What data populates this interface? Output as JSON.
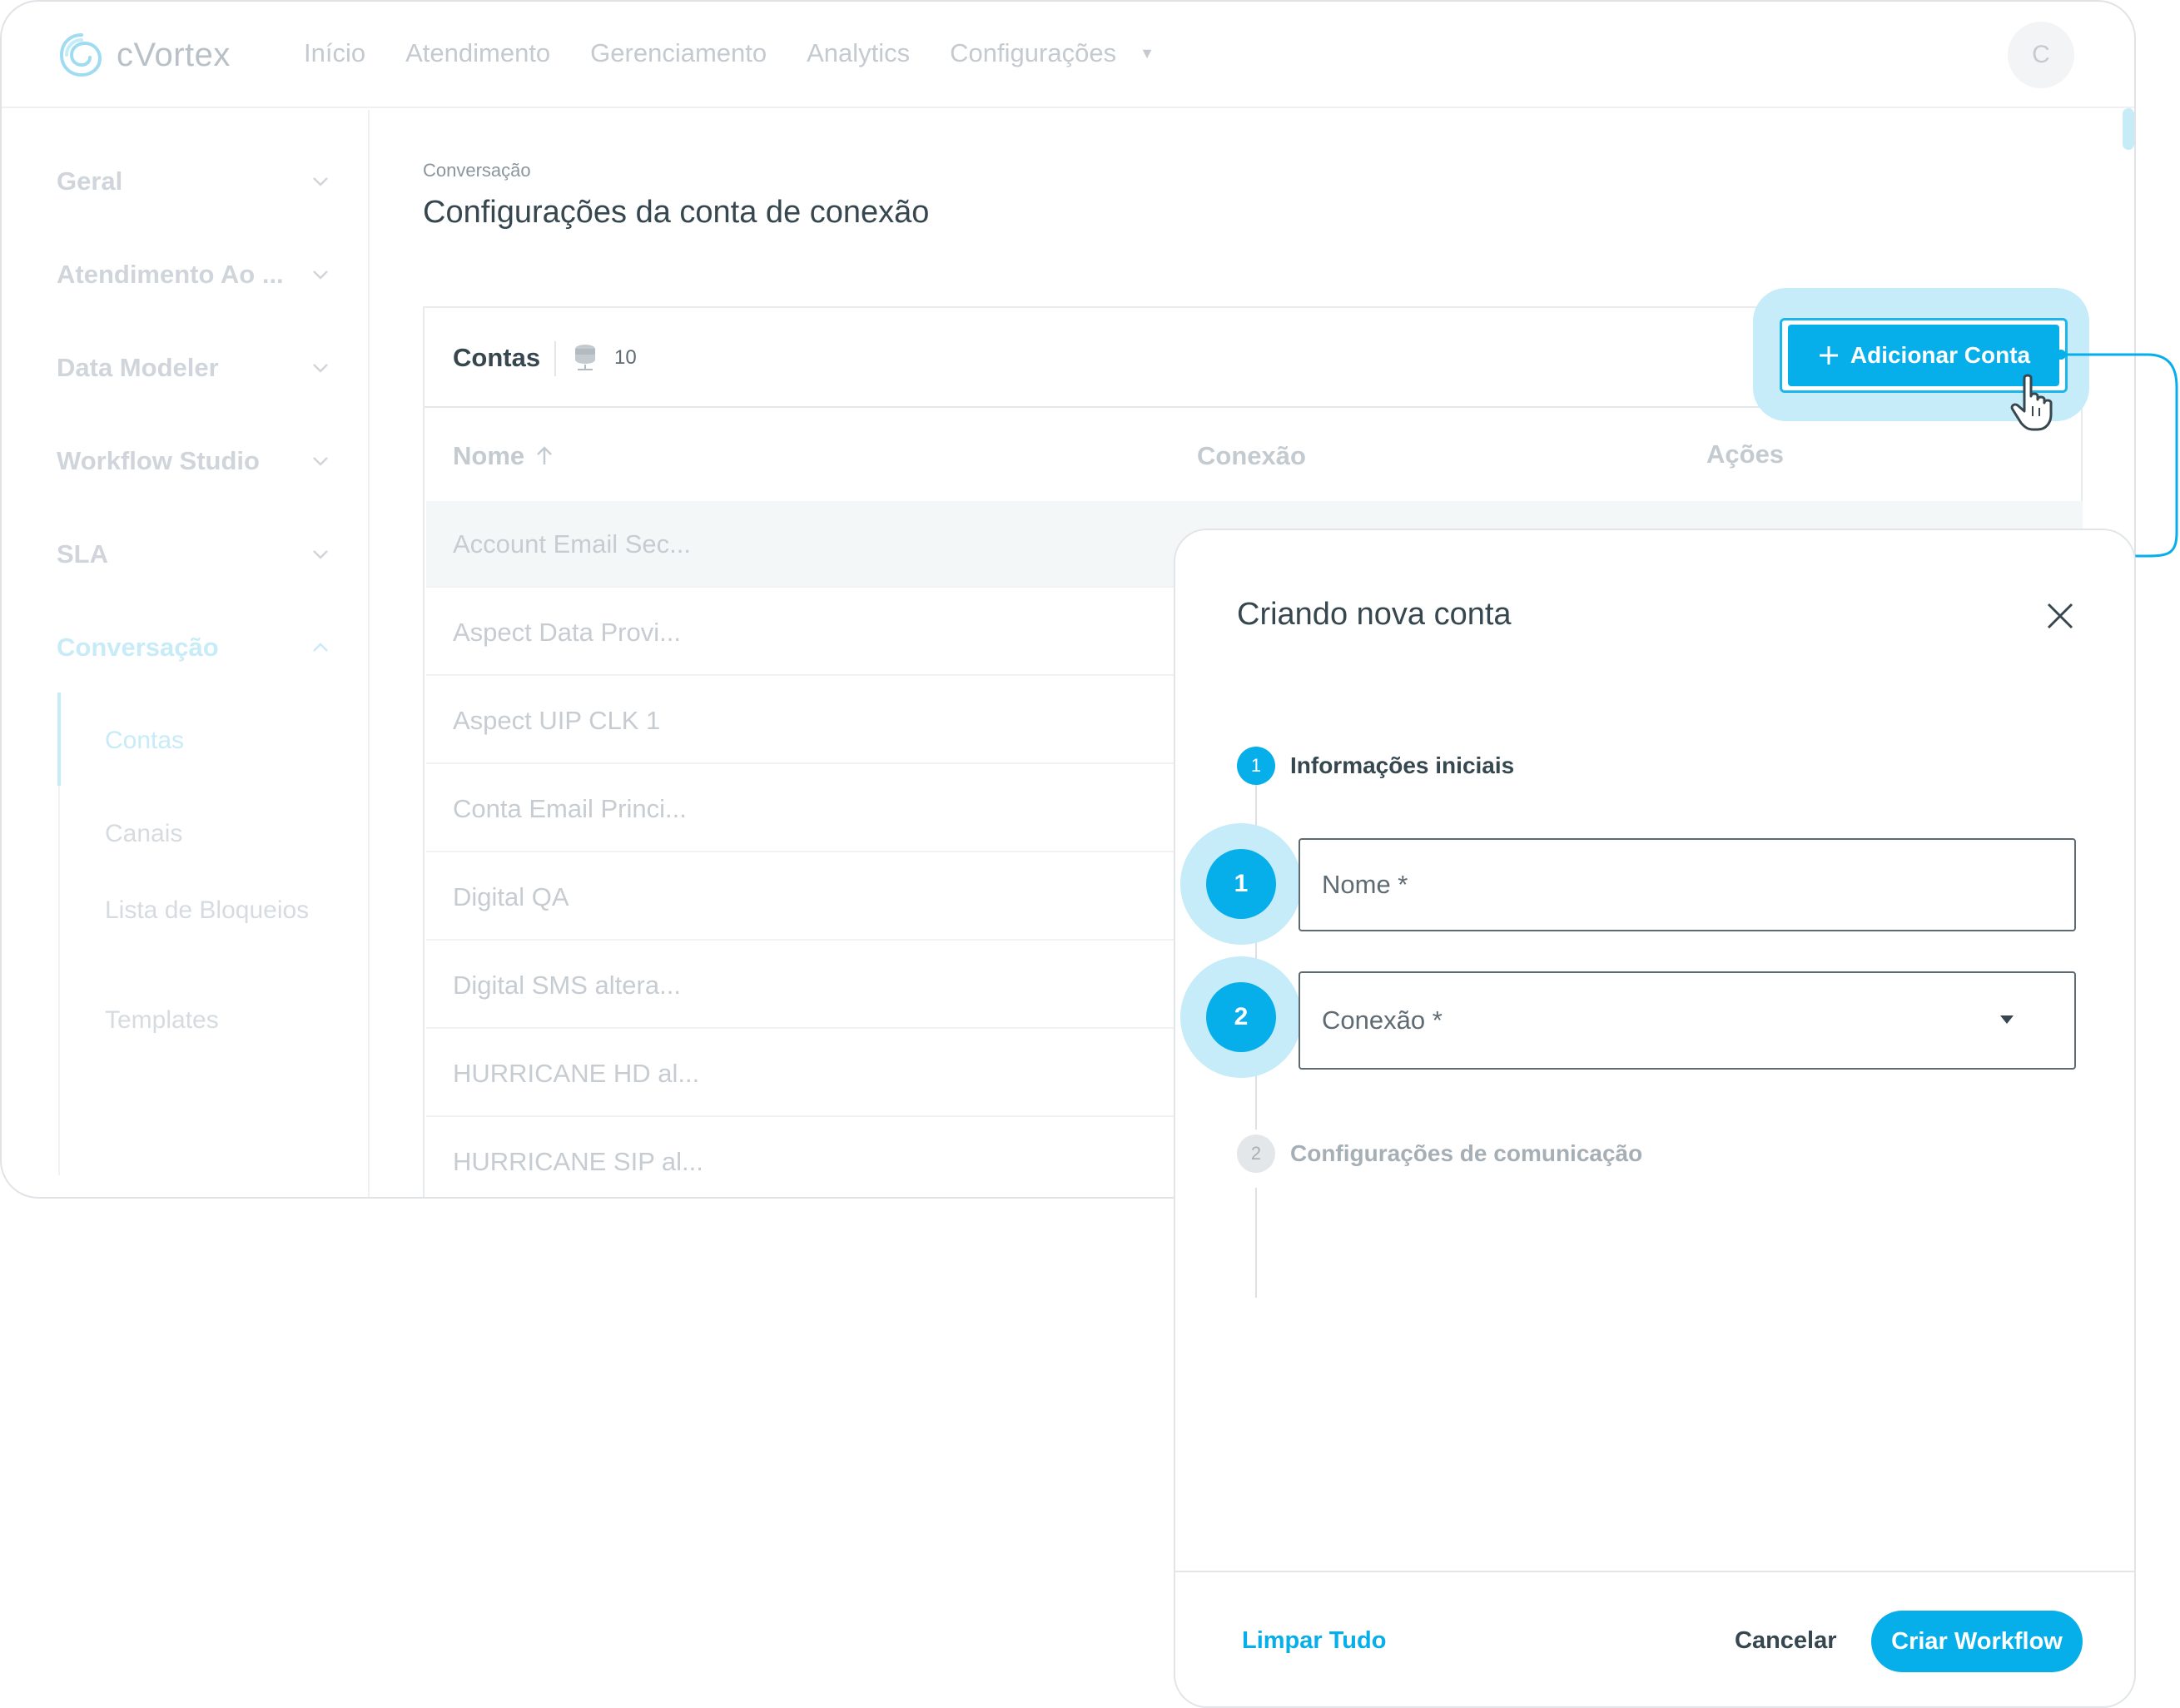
{
  "app": {
    "logo_text": "cVortex",
    "avatar_initial": "C"
  },
  "nav": {
    "items": [
      "Início",
      "Atendimento",
      "Gerenciamento",
      "Analytics",
      "Configurações"
    ]
  },
  "sidebar": {
    "items": [
      {
        "label": "Geral"
      },
      {
        "label": "Atendimento Ao ..."
      },
      {
        "label": "Data Modeler"
      },
      {
        "label": "Workflow Studio"
      },
      {
        "label": "SLA"
      },
      {
        "label": "Conversação"
      }
    ],
    "sub_items": [
      "Contas",
      "Canais",
      "Lista de Bloqueios",
      "Templates"
    ]
  },
  "page": {
    "breadcrumb": "Conversação",
    "title": "Configurações da conta de conexão"
  },
  "table": {
    "title": "Contas",
    "count": "10",
    "add_button": "Adicionar Conta",
    "columns": [
      "Nome",
      "Conexão",
      "Ações"
    ],
    "rows": [
      "Account Email Sec...",
      "Aspect Data Provi...",
      "Aspect UIP CLK 1",
      "Conta Email Princi...",
      "Digital QA",
      "Digital SMS altera...",
      "HURRICANE HD al...",
      "HURRICANE SIP al..."
    ]
  },
  "drawer": {
    "title": "Criando nova conta",
    "steps": [
      {
        "number": "1",
        "label": "Informações iniciais"
      },
      {
        "number": "2",
        "label": "Configurações de comunicação"
      }
    ],
    "callouts": [
      "1",
      "2"
    ],
    "fields": {
      "name_placeholder": "Nome *",
      "connection_placeholder": "Conexão *"
    },
    "buttons": {
      "clear": "Limpar Tudo",
      "cancel": "Cancelar",
      "submit": "Criar Workflow"
    }
  },
  "colors": {
    "accent": "#06aeea",
    "halo": "#c6ecf9",
    "text": "#37474f"
  }
}
